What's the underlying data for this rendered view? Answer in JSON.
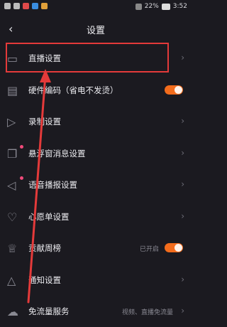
{
  "status_bar": {
    "time": "3:52",
    "battery": "22%"
  },
  "header": {
    "title": "设置",
    "back_icon": "chevron-left-icon"
  },
  "settings": {
    "items": [
      {
        "label": "直播设置",
        "icon": "tv-icon",
        "control": "chevron"
      },
      {
        "label": "硬件编码（省电不发烫）",
        "icon": "device-icon",
        "control": "toggle",
        "on": true
      },
      {
        "label": "录制设置",
        "icon": "video-icon",
        "control": "chevron"
      },
      {
        "label": "悬浮窗消息设置",
        "icon": "window-icon",
        "control": "chevron",
        "dot": true
      },
      {
        "label": "语音播报设置",
        "icon": "speaker-icon",
        "control": "chevron",
        "dot": true
      },
      {
        "label": "心愿单设置",
        "icon": "heart-icon",
        "control": "chevron"
      },
      {
        "label": "贡献周榜",
        "icon": "trophy-icon",
        "control": "toggle",
        "status": "已开启",
        "on": true
      },
      {
        "label": "通知设置",
        "icon": "bell-icon",
        "control": "chevron"
      },
      {
        "label": "免流量服务",
        "icon": "cloud-icon",
        "control": "chevron",
        "status": "视频、直播免流量"
      }
    ]
  },
  "colors": {
    "background": "#1b1a20",
    "accent": "#f36c1c",
    "highlight": "#e43a3a"
  }
}
